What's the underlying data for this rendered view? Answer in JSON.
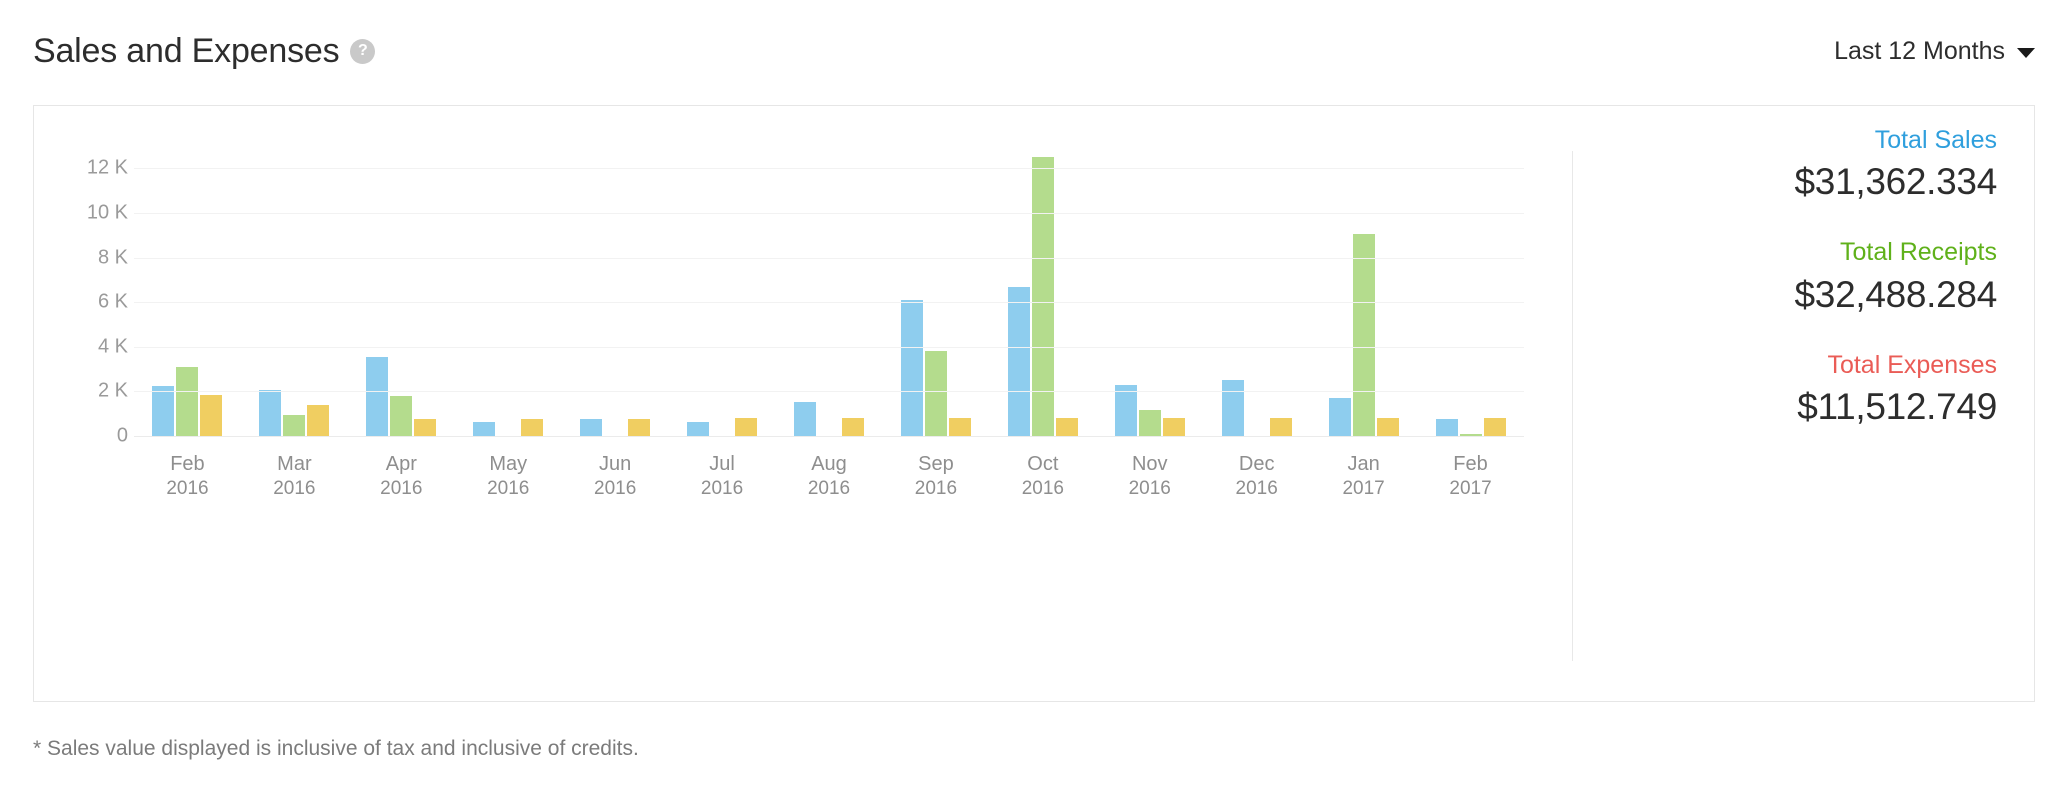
{
  "header": {
    "title": "Sales and Expenses",
    "help_icon": "help-circle-icon",
    "period": {
      "selected": "Last 12 Months",
      "caret_icon": "chevron-down-icon"
    }
  },
  "summary": {
    "items": [
      {
        "label": "Total Sales",
        "value": "$31,362.334",
        "color": "#2f9fdd"
      },
      {
        "label": "Total Receipts",
        "value": "$32,488.284",
        "color": "#5fb11a"
      },
      {
        "label": "Total Expenses",
        "value": "$11,512.749",
        "color": "#ea5c56"
      }
    ]
  },
  "footnote": "* Sales value displayed is inclusive of tax and inclusive of credits.",
  "chart_data": {
    "type": "bar",
    "title": "Sales and Expenses",
    "xlabel": "",
    "ylabel": "",
    "ylim": [
      0,
      13000
    ],
    "yticks": [
      0,
      2000,
      4000,
      6000,
      8000,
      10000,
      12000
    ],
    "ytick_labels": [
      "0",
      "2 K",
      "4 K",
      "6 K",
      "8 K",
      "10 K",
      "12 K"
    ],
    "grid": true,
    "legend_position": "none",
    "bar_mode": "grouped",
    "categories": [
      "Feb 2016",
      "Mar 2016",
      "Apr 2016",
      "May 2016",
      "Jun 2016",
      "Jul 2016",
      "Aug 2016",
      "Sep 2016",
      "Oct 2016",
      "Nov 2016",
      "Dec 2016",
      "Jan 2017",
      "Feb 2017"
    ],
    "category_months": [
      "Feb",
      "Mar",
      "Apr",
      "May",
      "Jun",
      "Jul",
      "Aug",
      "Sep",
      "Oct",
      "Nov",
      "Dec",
      "Jan",
      "Feb"
    ],
    "category_years": [
      "2016",
      "2016",
      "2016",
      "2016",
      "2016",
      "2016",
      "2016",
      "2016",
      "2016",
      "2016",
      "2016",
      "2017",
      "2017"
    ],
    "series": [
      {
        "name": "Sales",
        "color": "#8ecdee",
        "values": [
          2250,
          2080,
          3550,
          620,
          750,
          620,
          1520,
          6080,
          6680,
          2280,
          2520,
          1700,
          760
        ]
      },
      {
        "name": "Receipts",
        "color": "#b4dc8d",
        "values": [
          3100,
          950,
          1800,
          0,
          0,
          0,
          0,
          3800,
          12520,
          1150,
          0,
          9050,
          90
        ]
      },
      {
        "name": "Expenses",
        "color": "#f0ce61",
        "values": [
          1850,
          1400,
          780,
          780,
          780,
          790,
          790,
          790,
          790,
          800,
          790,
          790,
          800
        ]
      }
    ]
  }
}
